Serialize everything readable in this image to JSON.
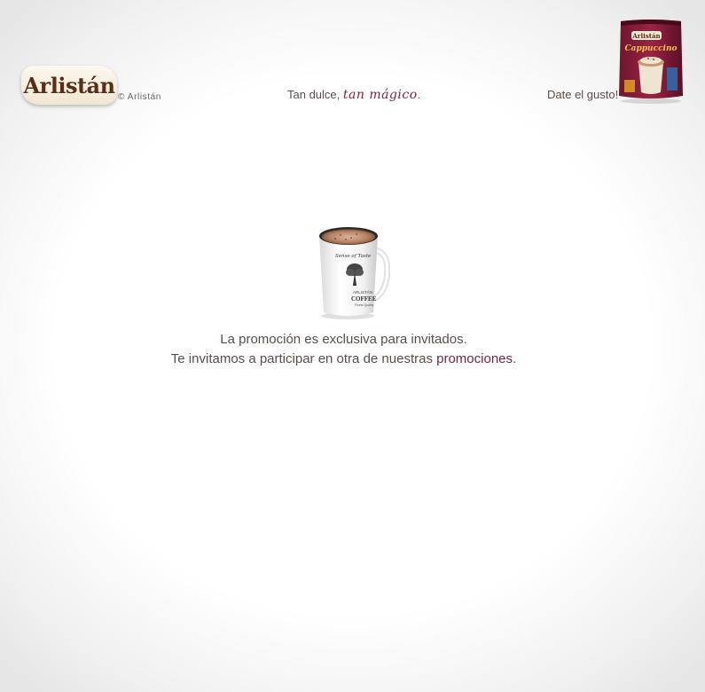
{
  "header": {
    "logo_text": "Arlistán",
    "copyright": "© Arlistán",
    "slogan_plain": "Tan dulce, ",
    "slogan_script": "tan mágico",
    "slogan_end": ".",
    "tagline": "Date el gusto!",
    "product_brand": "Arlistán",
    "product_name": "Cappuccino"
  },
  "main": {
    "mug_text_top": "Sense of Taste",
    "mug_text_brand": "ARLISTÁN",
    "mug_text_coffee": "COFFEE",
    "mug_text_bottom": "Finest Quality",
    "line1": "La promoción es exclusiva para invitados.",
    "line2_prefix": "Te invitamos a participar en otra de nuestras ",
    "link_text": "promociones",
    "line2_suffix": "."
  },
  "colors": {
    "accent": "#7a2443",
    "text": "#5a4f4a",
    "logo_brown": "#5b2d14"
  }
}
